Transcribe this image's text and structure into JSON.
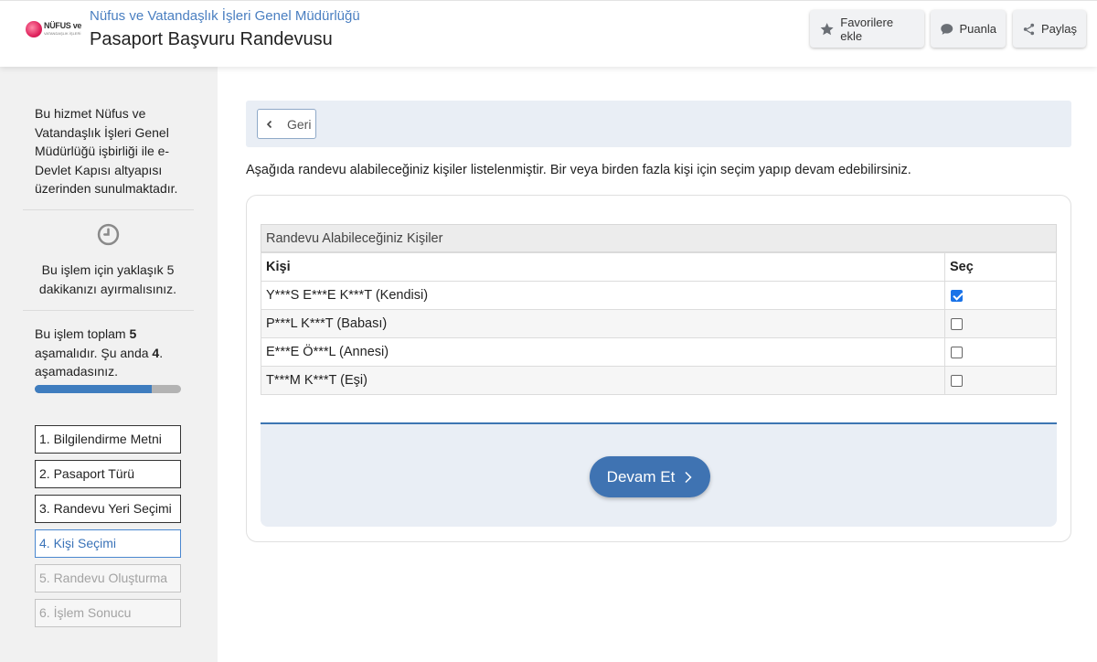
{
  "header": {
    "org_name": "Nüfus ve Vatandaşlık İşleri Genel Müdürlüğü",
    "title": "Pasaport Başvuru Randevusu",
    "logo_text_main": "NÜFUS ve",
    "logo_text_sub": "VATANDAŞLIK İŞLERİ",
    "buttons": {
      "favorite": "Favorilere ekle",
      "rate": "Puanla",
      "share": "Paylaş"
    }
  },
  "sidebar": {
    "info_text": "Bu hizmet Nüfus ve Vatandaşlık İşleri Genel Müdürlüğü işbirliği ile e-Devlet Kapısı altyapısı üzerinden sunulmaktadır.",
    "time_text": "Bu işlem için yaklaşık 5 dakikanızı ayırmalısınız.",
    "progress_pre": "Bu işlem toplam ",
    "progress_total": "5",
    "progress_mid": " aşamalıdır. Şu anda ",
    "progress_current": "4",
    "progress_post": ". aşamadasınız.",
    "progress_fraction": 0.8,
    "steps": [
      {
        "label": "1. Bilgilendirme Metni",
        "state": "done"
      },
      {
        "label": "2. Pasaport Türü",
        "state": "done"
      },
      {
        "label": "3. Randevu Yeri Seçimi",
        "state": "done"
      },
      {
        "label": "4. Kişi Seçimi",
        "state": "active"
      },
      {
        "label": "5. Randevu Oluşturma",
        "state": "disabled"
      },
      {
        "label": "6. İşlem Sonucu",
        "state": "disabled"
      }
    ]
  },
  "main": {
    "back_label": "Geri",
    "intro_text": "Aşağıda randevu alabileceğiniz kişiler listelenmiştir. Bir veya birden fazla kişi için seçim yapıp devam edebilirsiniz.",
    "table": {
      "caption": "Randevu Alabileceğiniz Kişiler",
      "headers": {
        "person": "Kişi",
        "select": "Seç"
      },
      "rows": [
        {
          "person": "Y***S E***E K***T (Kendisi)",
          "selected": true
        },
        {
          "person": "P***L K***T (Babası)",
          "selected": false
        },
        {
          "person": "E***E Ö***L (Annesi)",
          "selected": false
        },
        {
          "person": "T***M K***T (Eşi)",
          "selected": false
        }
      ]
    },
    "continue_label": "Devam Et"
  },
  "colors": {
    "accent": "#3f73b2",
    "org_link": "#4a7fc1",
    "panel_bg": "#e9eef5",
    "sidebar_bg": "#f1f1f1"
  }
}
